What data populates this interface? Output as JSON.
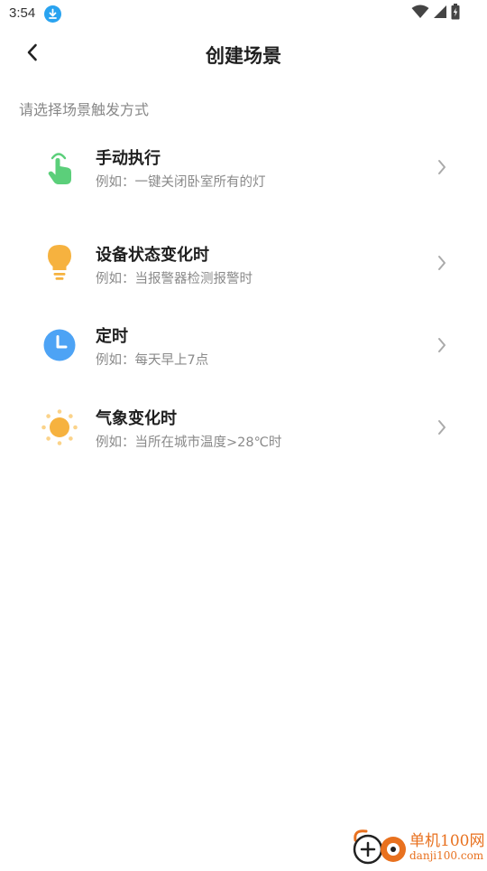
{
  "status_bar": {
    "time": "3:54",
    "icons": [
      "download-icon",
      "wifi-icon",
      "signal-icon",
      "battery-charging-icon"
    ]
  },
  "header": {
    "back_icon": "chevron-left-icon",
    "title": "创建场景"
  },
  "section_label": "请选择场景触发方式",
  "triggers": [
    {
      "title": "手动执行",
      "desc": "例如：一键关闭卧室所有的灯",
      "icon": "hand-tap-icon",
      "color": "#5bcf7a"
    },
    {
      "title": "设备状态变化时",
      "desc": "例如：当报警器检测报警时",
      "icon": "lightbulb-icon",
      "color": "#f6b23f"
    },
    {
      "title": "定时",
      "desc": "例如：每天早上7点",
      "icon": "clock-icon",
      "color": "#4da3f5"
    },
    {
      "title": "气象变化时",
      "desc": "例如：当所在城市温度>28℃时",
      "icon": "sun-icon",
      "color": "#f6b23f"
    }
  ],
  "watermark": {
    "name": "单机100网",
    "url": "danji100.com"
  }
}
